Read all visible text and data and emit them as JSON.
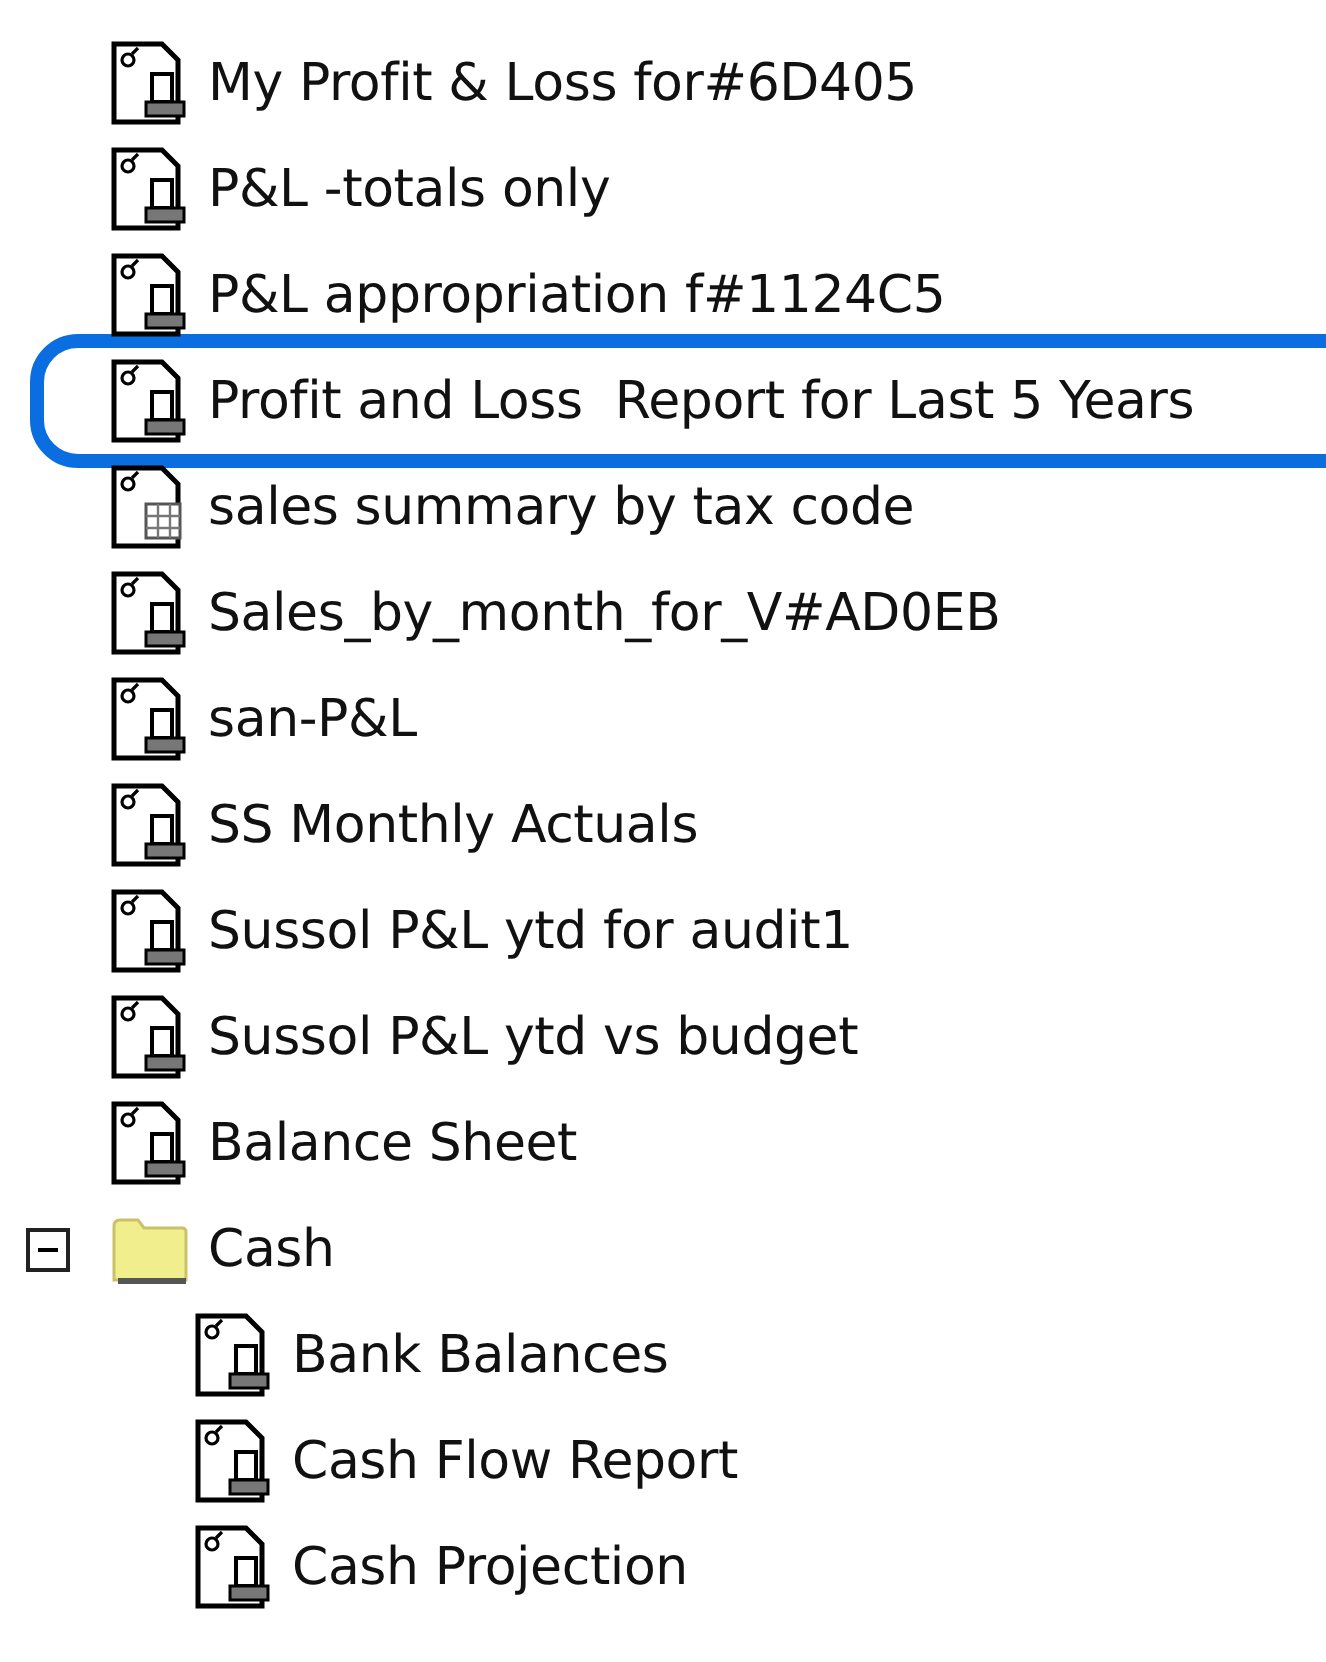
{
  "tree": [
    {
      "kind": "report",
      "label": "My Profit & Loss for#6D405",
      "selected": false
    },
    {
      "kind": "report",
      "label": "P&L -totals only",
      "selected": false
    },
    {
      "kind": "report",
      "label": "P&L appropriation f#1124C5",
      "selected": false
    },
    {
      "kind": "report",
      "label": "Profit and Loss  Report for Last 5 Years",
      "selected": true
    },
    {
      "kind": "summary",
      "label": "sales summary by tax code",
      "selected": false
    },
    {
      "kind": "report",
      "label": "Sales_by_month_for_V#AD0EB",
      "selected": false
    },
    {
      "kind": "report",
      "label": "san-P&L",
      "selected": false
    },
    {
      "kind": "report",
      "label": "SS Monthly Actuals",
      "selected": false
    },
    {
      "kind": "report",
      "label": "Sussol P&L ytd for audit1",
      "selected": false
    },
    {
      "kind": "report",
      "label": "Sussol P&L ytd vs budget",
      "selected": false
    },
    {
      "kind": "report",
      "label": "Balance Sheet",
      "selected": false
    },
    {
      "kind": "folder",
      "label": "Cash",
      "selected": false,
      "expanded": true,
      "children": [
        {
          "kind": "report",
          "label": "Bank Balances",
          "selected": false
        },
        {
          "kind": "report",
          "label": "Cash Flow Report",
          "selected": false
        },
        {
          "kind": "report",
          "label": "Cash Projection",
          "selected": false
        }
      ]
    }
  ]
}
